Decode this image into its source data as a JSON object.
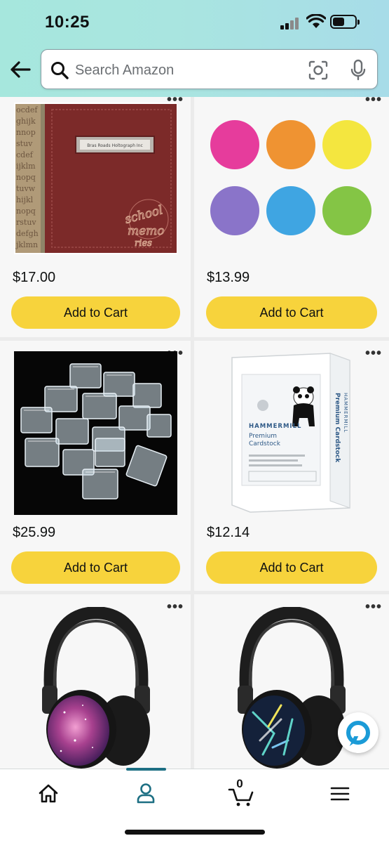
{
  "status_bar": {
    "time": "10:25"
  },
  "search": {
    "placeholder": "Search Amazon"
  },
  "products": [
    {
      "price": "$17.00",
      "cart_label": "Add to Cart",
      "image": "school-memories-photo-album"
    },
    {
      "price": "$13.99",
      "cart_label": "Add to Cart",
      "image": "colored-circle-stickers"
    },
    {
      "price": "$25.99",
      "cart_label": "Add to Cart",
      "image": "clear-plastic-storage-boxes"
    },
    {
      "price": "$12.14",
      "cart_label": "Add to Cart",
      "image": "hammermill-premium-cardstock"
    },
    {
      "image": "galaxy-print-kids-earmuffs"
    },
    {
      "image": "splatter-print-kids-earmuffs"
    }
  ],
  "album_text": {
    "cover_word_1": "school",
    "cover_word_2": "memo",
    "cover_word_3": "ries"
  },
  "cardstock_box": {
    "brand": "HAMMERMILL",
    "line1": "Premium",
    "line2": "Cardstock"
  },
  "sticker_colors": [
    "#e63c9c",
    "#ef9332",
    "#f4e63f",
    "#8a74c9",
    "#3fa5e2",
    "#84c545"
  ],
  "bottom_nav": {
    "cart_count": "0",
    "active": "account"
  },
  "colors": {
    "accent": "#1d6f83",
    "cart_button": "#f7d33c",
    "alexa": "#1b9bd7"
  }
}
